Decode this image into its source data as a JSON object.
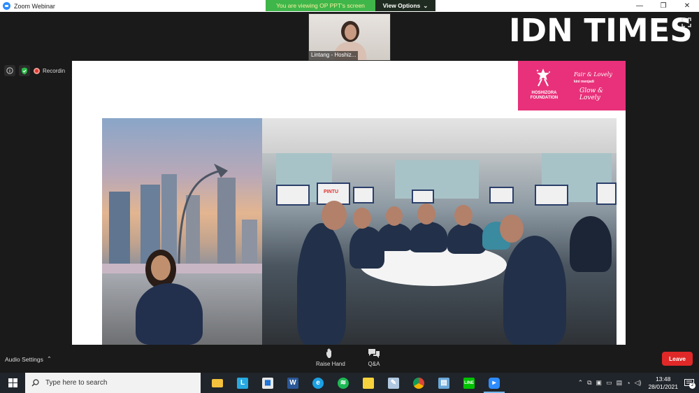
{
  "window": {
    "title": "Zoom Webinar",
    "banner": "You are viewing OP PPT's screen",
    "view_options": "View Options"
  },
  "participant": {
    "name": "Lintang - Hoshiz..."
  },
  "watermark": {
    "text": "IDN TIMES"
  },
  "status": {
    "recording_label": "Recordin"
  },
  "slide": {
    "logo_org": "HOSHIZORA FOUNDATION",
    "logo_brand_1": "Fair & Lovely",
    "logo_brand_1_sub": "kini menjadi",
    "logo_brand_2": "Glow & Lovely",
    "screen_label": "PINTU"
  },
  "controls": {
    "audio_settings": "Audio Settings",
    "raise_hand": "Raise Hand",
    "qa": "Q&A",
    "leave": "Leave"
  },
  "taskbar": {
    "search_placeholder": "Type here to search",
    "time": "13:48",
    "date": "28/01/2021",
    "notification_count": "2"
  },
  "colors": {
    "banner_green": "#3fb64a",
    "brand_pink": "#e8317a",
    "leave_red": "#e02828",
    "taskbar": "#20252b"
  }
}
